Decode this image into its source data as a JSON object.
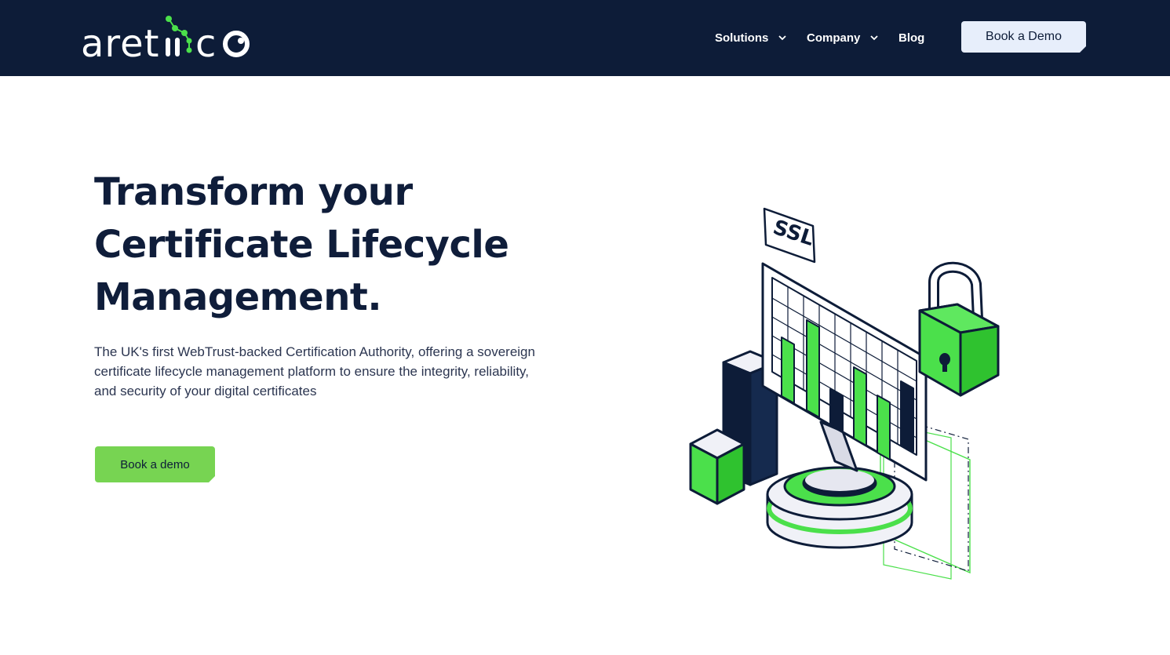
{
  "brand": {
    "name": "aretiico",
    "accent": "#4be04b",
    "navy": "#0d1c38"
  },
  "nav": {
    "items": [
      {
        "label": "Solutions",
        "has_dropdown": true,
        "icon": "chevron-down-icon"
      },
      {
        "label": "Company",
        "has_dropdown": true,
        "icon": "chevron-down-icon"
      },
      {
        "label": "Blog",
        "has_dropdown": false
      }
    ],
    "demo_button": "Book a Demo"
  },
  "hero": {
    "title_lines": [
      "Transform your",
      "Certificate Lifecycle",
      "Management."
    ],
    "description": "The UK's first WebTrust-backed Certification Authority, offering a sovereign certificate lifecycle management platform to ensure the integrity, reliability, and security of your digital certificates",
    "cta_label": "Book a demo",
    "cta_color": "#77d452"
  },
  "illustration": {
    "badge_text": "SSL",
    "icons": [
      "ssl-badge-icon",
      "monitor-chart-icon",
      "padlock-icon",
      "cube-icon",
      "pedestal-icon"
    ]
  }
}
